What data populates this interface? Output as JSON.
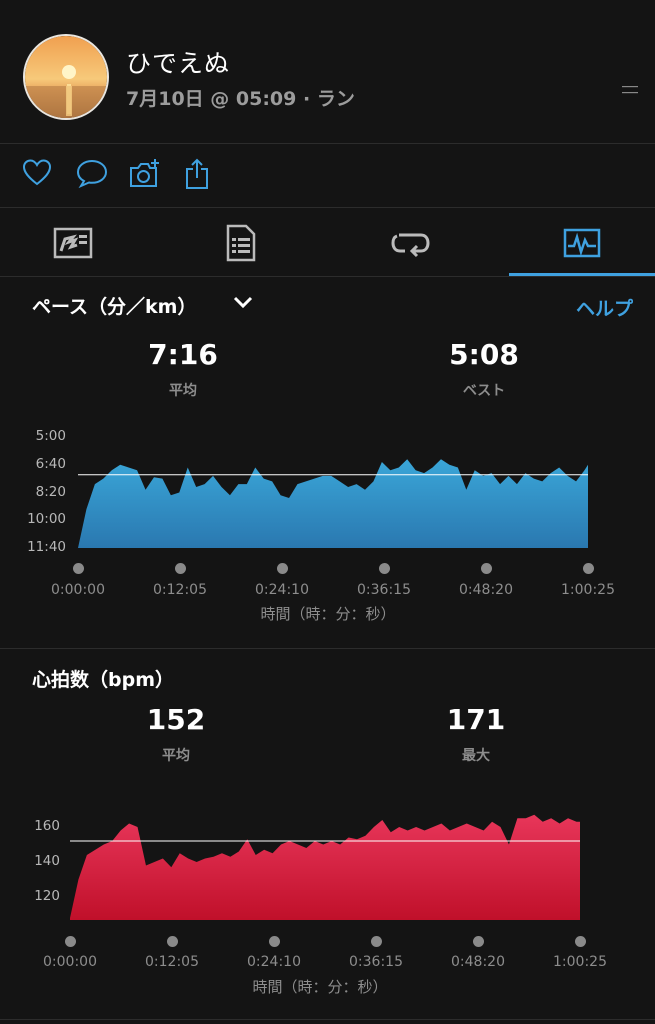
{
  "header": {
    "user_name": "ひでえぬ",
    "activity_meta": "7月10日 @ 05:09 · ラン"
  },
  "actions": [
    "heart-icon",
    "comment-icon",
    "add-photo-icon",
    "share-icon"
  ],
  "tabs": [
    {
      "name": "tab-summary",
      "icon": "summary-icon",
      "selected": false
    },
    {
      "name": "tab-details",
      "icon": "details-icon",
      "selected": false
    },
    {
      "name": "tab-laps",
      "icon": "laps-icon",
      "selected": false
    },
    {
      "name": "tab-charts",
      "icon": "charts-icon",
      "selected": true
    }
  ],
  "pace": {
    "title": "ペース（分／km）",
    "help": "ヘルプ",
    "avg_value": "7:16",
    "avg_label": "平均",
    "best_value": "5:08",
    "best_label": "ベスト",
    "x_axis_title": "時間（時：分：秒）"
  },
  "heart": {
    "title": "心拍数（bpm）",
    "avg_value": "152",
    "avg_label": "平均",
    "max_value": "171",
    "max_label": "最大",
    "x_axis_title": "時間（時：分：秒）"
  },
  "colors": {
    "accent": "#3fa1e0",
    "pace_fill_top": "#3aa6d8",
    "pace_fill_bottom": "#2a78b0",
    "heart_fill_top": "#e8365a",
    "heart_fill_bottom": "#c0102a"
  },
  "chart_data": [
    {
      "type": "area",
      "ylabel": "",
      "xlabel": "時間（時：分：秒）",
      "y_ticks": [
        "5:00",
        "6:40",
        "8:20",
        "10:00",
        "11:40"
      ],
      "y_tick_values_sec": [
        300,
        400,
        500,
        600,
        700
      ],
      "y_inverted": true,
      "x_ticks": [
        "0:00:00",
        "0:12:05",
        "0:24:10",
        "0:36:15",
        "0:48:20",
        "1:00:25"
      ],
      "xlim_sec": [
        0,
        3625
      ],
      "reference_line_sec": 436,
      "x_sec": [
        0,
        60,
        120,
        180,
        240,
        300,
        360,
        420,
        480,
        540,
        600,
        660,
        720,
        780,
        840,
        900,
        960,
        1020,
        1080,
        1140,
        1200,
        1260,
        1320,
        1380,
        1440,
        1500,
        1560,
        1620,
        1680,
        1740,
        1800,
        1860,
        1920,
        1980,
        2040,
        2100,
        2160,
        2220,
        2280,
        2340,
        2400,
        2460,
        2520,
        2580,
        2640,
        2700,
        2760,
        2820,
        2880,
        2940,
        3000,
        3060,
        3120,
        3180,
        3240,
        3300,
        3360,
        3420,
        3480,
        3540,
        3600,
        3625
      ],
      "y_sec": [
        700,
        560,
        470,
        450,
        420,
        400,
        410,
        420,
        490,
        445,
        450,
        510,
        500,
        410,
        480,
        470,
        440,
        480,
        510,
        470,
        470,
        410,
        450,
        460,
        510,
        520,
        470,
        460,
        450,
        440,
        440,
        460,
        480,
        470,
        490,
        460,
        390,
        420,
        410,
        380,
        420,
        430,
        410,
        380,
        400,
        410,
        490,
        420,
        440,
        430,
        470,
        440,
        470,
        430,
        450,
        460,
        430,
        410,
        440,
        460,
        420,
        400
      ]
    },
    {
      "type": "area",
      "ylabel": "",
      "xlabel": "時間（時：分：秒）",
      "y_ticks": [
        "160",
        "140",
        "120"
      ],
      "ylim": [
        105,
        175
      ],
      "x_ticks": [
        "0:00:00",
        "0:12:05",
        "0:24:10",
        "0:36:15",
        "0:48:20",
        "1:00:25"
      ],
      "xlim_sec": [
        0,
        3625
      ],
      "reference_line": 152,
      "x_sec": [
        0,
        60,
        120,
        180,
        240,
        300,
        360,
        420,
        480,
        540,
        600,
        660,
        720,
        780,
        840,
        900,
        960,
        1020,
        1080,
        1140,
        1200,
        1260,
        1320,
        1380,
        1440,
        1500,
        1560,
        1620,
        1680,
        1740,
        1800,
        1860,
        1920,
        1980,
        2040,
        2100,
        2160,
        2220,
        2280,
        2340,
        2400,
        2460,
        2520,
        2580,
        2640,
        2700,
        2760,
        2820,
        2880,
        2940,
        3000,
        3060,
        3120,
        3180,
        3240,
        3300,
        3360,
        3420,
        3480,
        3540,
        3600,
        3625
      ],
      "y": [
        108,
        130,
        144,
        147,
        150,
        152,
        158,
        162,
        160,
        138,
        140,
        142,
        137,
        145,
        142,
        140,
        142,
        143,
        145,
        143,
        146,
        153,
        144,
        147,
        145,
        150,
        152,
        150,
        148,
        152,
        150,
        152,
        150,
        154,
        153,
        155,
        160,
        164,
        157,
        160,
        158,
        160,
        158,
        160,
        162,
        158,
        160,
        162,
        160,
        158,
        163,
        160,
        150,
        165,
        165,
        167,
        163,
        165,
        162,
        165,
        163,
        163
      ]
    }
  ]
}
